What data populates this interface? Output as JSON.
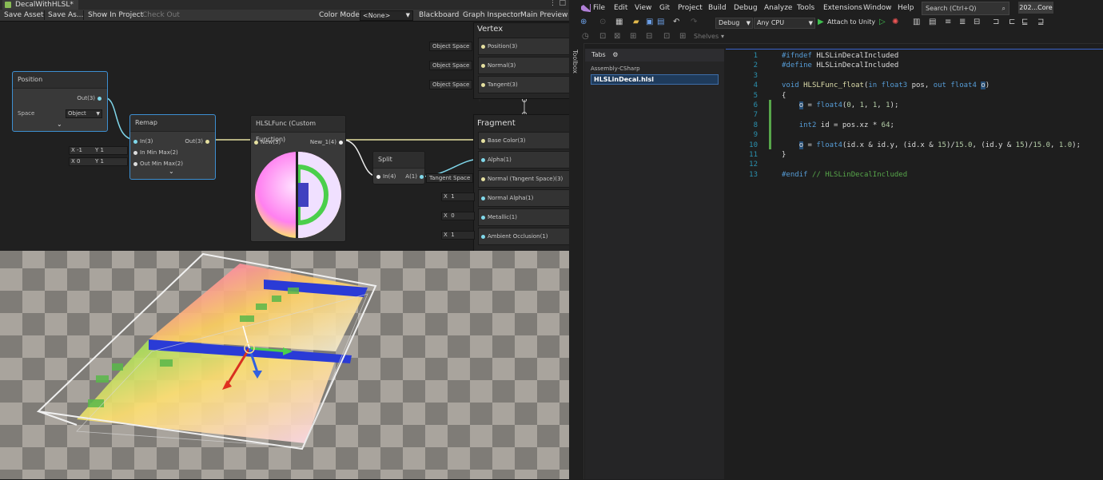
{
  "shader_graph": {
    "tab_title": "DecalWithHLSL*",
    "toolbar": {
      "save_asset": "Save Asset",
      "save_as": "Save As...",
      "show_in_project": "Show In Project",
      "check_out": "Check Out",
      "color_mode_label": "Color Mode",
      "color_mode_value": "<None>",
      "blackboard": "Blackboard",
      "graph_inspector": "Graph Inspector",
      "main_preview": "Main Preview"
    },
    "nodes": {
      "position": {
        "title": "Position",
        "out_port": "Out(3)",
        "space_label": "Space",
        "space_value": "Object"
      },
      "remap": {
        "title": "Remap",
        "in_port": "In(3)",
        "in_min_max": "In Min Max(2)",
        "out_min_max": "Out Min Max(2)",
        "out_port": "Out(3)",
        "in_min_max_x_label": "X",
        "in_min_max_x": "-1",
        "in_min_max_y_label": "Y",
        "in_min_max_y": "1",
        "out_min_max_x_label": "X",
        "out_min_max_x": "0",
        "out_min_max_y_label": "Y",
        "out_min_max_y": "1"
      },
      "hlsl_func": {
        "title": "HLSLFunc (Custom Function)",
        "in_port": "New(3)",
        "out_port": "New_1(4)"
      },
      "split": {
        "title": "Split",
        "in_port": "In(4)",
        "out_port": "A(1)"
      }
    },
    "vertex": {
      "title": "Vertex",
      "ports": [
        {
          "label": "Object Space",
          "name": "Position(3)"
        },
        {
          "label": "Object Space",
          "name": "Normal(3)"
        },
        {
          "label": "Object Space",
          "name": "Tangent(3)"
        }
      ]
    },
    "fragment": {
      "title": "Fragment",
      "base_color": "Base Color(3)",
      "alpha": "Alpha(1)",
      "normal_ts_label": "Tangent Space",
      "normal_ts": "Normal (Tangent Space)(3)",
      "normal_alpha_x": "X",
      "normal_alpha_val": "1",
      "normal_alpha": "Normal Alpha(1)",
      "metallic_x": "X",
      "metallic_val": "0",
      "metallic": "Metallic(1)",
      "ao_x": "X",
      "ao_val": "1",
      "ao": "Ambient Occlusion(1)"
    }
  },
  "vs": {
    "menu": [
      "File",
      "Edit",
      "View",
      "Git",
      "Project",
      "Build",
      "Debug",
      "Analyze",
      "Tools",
      "Extensions",
      "Window",
      "Help"
    ],
    "search_placeholder": "Search (Ctrl+Q)",
    "project_badge": "202...Core",
    "config": "Debug",
    "platform": "Any CPU",
    "attach": "Attach to Unity",
    "shelves": "Shelves",
    "toolbox": "Toolbox",
    "tabs_title": "Tabs",
    "tabs_project": "Assembly-CSharp",
    "tabs_file": "HLSLinDecal.hlsl",
    "line_numbers": [
      "1",
      "2",
      "3",
      "4",
      "5",
      "6",
      "7",
      "8",
      "9",
      "10",
      "11",
      "12",
      "13"
    ]
  },
  "colors": {
    "accent": "#3d8fd1",
    "vs_keyword": "#569cd6",
    "vs_function": "#dcdcaa",
    "vs_comment": "#57a64a",
    "vs_line_number": "#2b91af"
  }
}
